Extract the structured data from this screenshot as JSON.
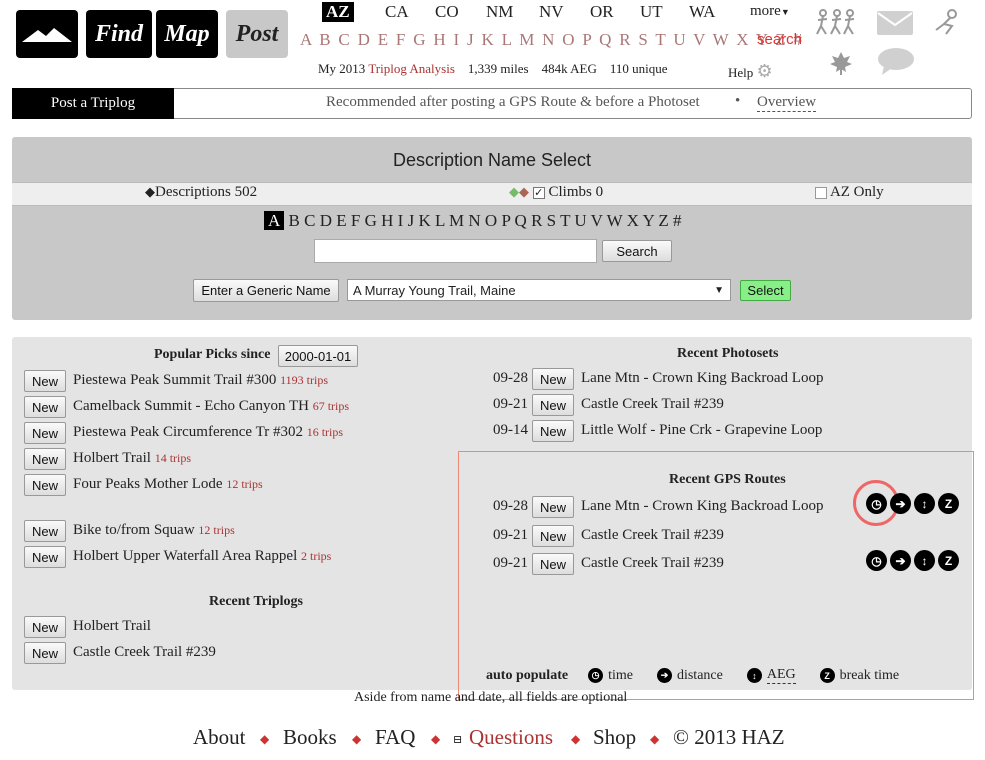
{
  "nav": {
    "find": "Find",
    "map": "Map",
    "post": "Post",
    "states": [
      "AZ",
      "CA",
      "CO",
      "NM",
      "NV",
      "OR",
      "UT",
      "WA"
    ],
    "active_state": "AZ",
    "more": "more",
    "letters": "A B C D E F G H I J K L M N O P Q R S T U V W X Y Z #",
    "search": "search",
    "stats": {
      "prefix": "My 2013",
      "link": "Triplog Analysis",
      "miles": "1,339 miles",
      "aeg": "484k AEG",
      "unique": "110 unique"
    },
    "help": "Help"
  },
  "postbar": {
    "title": "Post a Triplog",
    "hint": "Recommended after posting a GPS Route & before a Photoset",
    "bullet": "•",
    "overview": "Overview"
  },
  "desc_select": {
    "title": "Description Name Select",
    "descriptions": "Descriptions 502",
    "climbs": "Climbs 0",
    "az_only": "AZ Only",
    "letters": [
      "A",
      "B",
      "C",
      "D",
      "E",
      "F",
      "G",
      "H",
      "I",
      "J",
      "K",
      "L",
      "M",
      "N",
      "O",
      "P",
      "Q",
      "R",
      "S",
      "T",
      "U",
      "V",
      "W",
      "X",
      "Y",
      "Z",
      "#"
    ],
    "active_letter": "A",
    "search_value": "",
    "search_btn": "Search",
    "generic_btn": "Enter a Generic Name",
    "select_value": "A Murray Young Trail, Maine",
    "select_btn": "Select"
  },
  "popular": {
    "title": "Popular Picks since",
    "since": "2000-01-01",
    "new_label": "New",
    "items": [
      {
        "name": "Piestewa Peak Summit Trail #300",
        "trips": "1193 trips"
      },
      {
        "name": "Camelback Summit - Echo Canyon TH",
        "trips": "67 trips"
      },
      {
        "name": "Piestewa Peak Circumference Tr #302",
        "trips": "16 trips"
      },
      {
        "name": "Holbert Trail",
        "trips": "14 trips"
      },
      {
        "name": "Four Peaks Mother Lode",
        "trips": "12 trips"
      },
      {
        "name": "Bike to/from Squaw",
        "trips": "12 trips"
      },
      {
        "name": "Holbert Upper Waterfall Area Rappel",
        "trips": "2 trips"
      }
    ]
  },
  "recent_triplogs": {
    "title": "Recent Triplogs",
    "items": [
      "Holbert Trail",
      "Castle Creek Trail #239"
    ]
  },
  "recent_photosets": {
    "title": "Recent Photosets",
    "items": [
      {
        "date": "09-28",
        "name": "Lane Mtn - Crown King Backroad Loop"
      },
      {
        "date": "09-21",
        "name": "Castle Creek Trail #239"
      },
      {
        "date": "09-14",
        "name": "Little Wolf - Pine Crk - Grapevine Loop"
      }
    ]
  },
  "recent_gps": {
    "title": "Recent GPS Routes",
    "items": [
      {
        "date": "09-28",
        "name": "Lane Mtn - Crown King Backroad Loop"
      },
      {
        "date": "09-21",
        "name": "Castle Creek Trail #239"
      },
      {
        "date": "09-21",
        "name": "Castle Creek Trail #239"
      }
    ]
  },
  "legend": {
    "title": "auto populate",
    "time": "time",
    "distance": "distance",
    "aeg": "AEG",
    "break": "break time"
  },
  "optional_note": "Aside from name and date, all fields are optional",
  "footer": {
    "about": "About",
    "books": "Books",
    "faq": "FAQ",
    "questions": "Questions",
    "shop": "Shop",
    "copyright": "© 2013 HAZ"
  },
  "colors": {
    "accent_red": "#a33",
    "select_green": "#8e8",
    "highlight_ring": "#e66"
  }
}
